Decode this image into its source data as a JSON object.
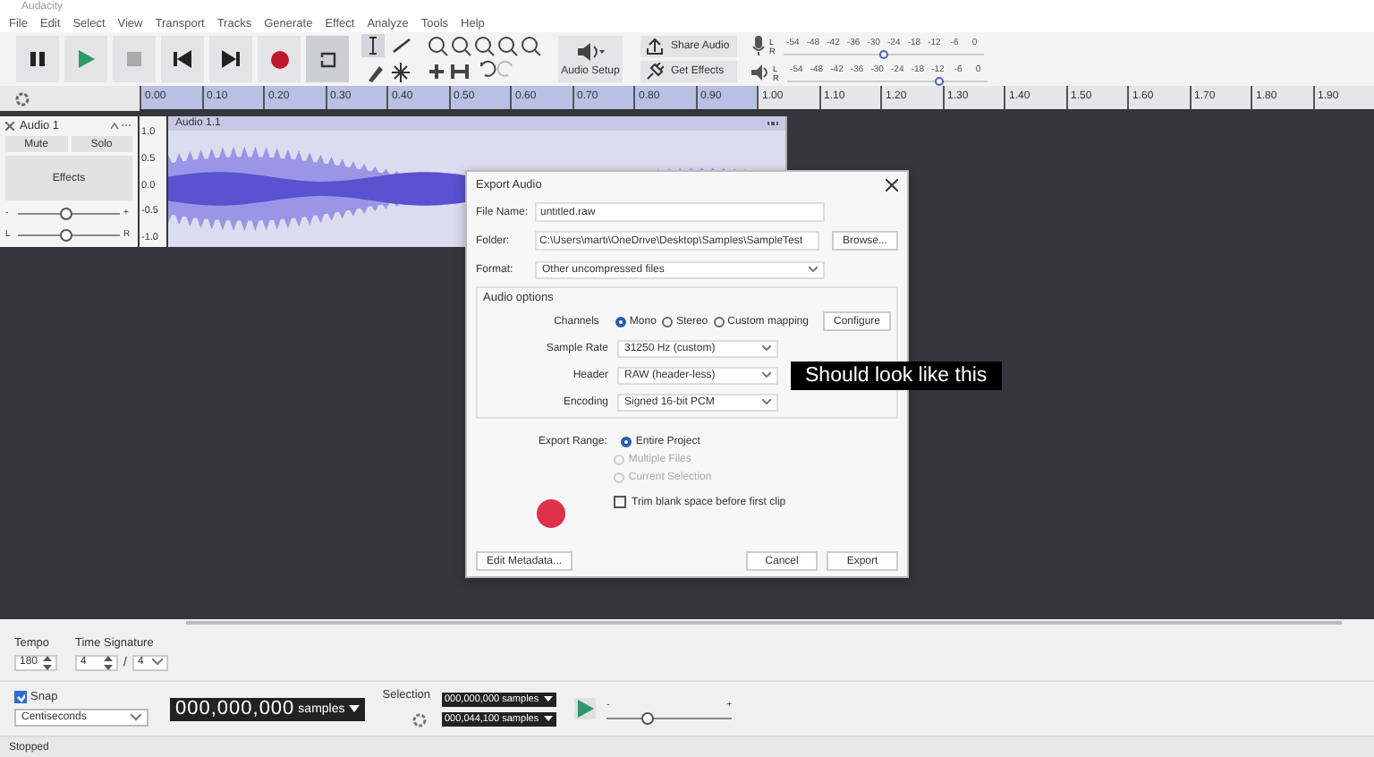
{
  "window": {
    "title": "Audacity"
  },
  "menu": [
    "File",
    "Edit",
    "Select",
    "View",
    "Transport",
    "Tracks",
    "Generate",
    "Effect",
    "Analyze",
    "Tools",
    "Help"
  ],
  "transport": [
    {
      "kind": "pause",
      "on": false
    },
    {
      "kind": "play",
      "on": false
    },
    {
      "kind": "stop",
      "on": false
    },
    {
      "kind": "skip-start",
      "on": false
    },
    {
      "kind": "skip-end",
      "on": false
    },
    {
      "kind": "record",
      "on": false
    },
    {
      "kind": "loop",
      "on": true
    }
  ],
  "audio_setup": "Audio Setup",
  "share_audio": "Share Audio",
  "get_effects": "Get Effects",
  "meters": [
    {
      "kind": "record",
      "channels": [
        "L",
        "R"
      ],
      "scale": [
        "-54",
        "-48",
        "-42",
        "-36",
        "-30",
        "-24",
        "-18",
        "-12",
        "-6",
        "0"
      ],
      "level": 0.5
    },
    {
      "kind": "playback",
      "channels": [
        "L",
        "R"
      ],
      "scale": [
        "-54",
        "-48",
        "-42",
        "-36",
        "-30",
        "-24",
        "-18",
        "-12",
        "-6",
        "0"
      ],
      "level": 0.76
    }
  ],
  "ruler": {
    "ticks": [
      "0.00",
      "0.10",
      "0.20",
      "0.30",
      "0.40",
      "0.50",
      "0.60",
      "0.70",
      "0.80",
      "0.90",
      "1.00",
      "1.10",
      "1.20",
      "1.30",
      "1.40",
      "1.50",
      "1.60",
      "1.70",
      "1.80",
      "1.90"
    ]
  },
  "track": {
    "name": "Audio 1",
    "mute": "Mute",
    "solo": "Solo",
    "effects": "Effects",
    "gain_labels": [
      "-",
      "+"
    ],
    "gain": {
      "level": 0.48
    },
    "pan_labels": [
      "L",
      "R"
    ],
    "pan": {
      "level": 0.48
    },
    "scale": [
      "1.0",
      "0.5",
      "0.0",
      "-0.5",
      "-1.0"
    ],
    "clip_title": "Audio 1.1"
  },
  "export_dialog": {
    "title": "Export Audio",
    "file_name": {
      "label": "File Name:",
      "value": "untitled.raw"
    },
    "folder": {
      "label": "Folder:",
      "value": "C:\\Users\\marti\\OneDrive\\Desktop\\Samples\\SampleTest",
      "button": "Browse..."
    },
    "format": {
      "label": "Format:",
      "value": "Other uncompressed files"
    },
    "audio_options": {
      "title": "Audio options",
      "channels_label": "Channels",
      "channels": [
        {
          "label": "Mono",
          "selected": true
        },
        {
          "label": "Stereo",
          "selected": false
        },
        {
          "label": "Custom mapping",
          "selected": false
        }
      ],
      "configure": "Configure",
      "dropdowns": [
        {
          "label": "Sample Rate",
          "value": "31250 Hz (custom)"
        },
        {
          "label": "Header",
          "value": "RAW (header-less)"
        },
        {
          "label": "Encoding",
          "value": "Signed 16-bit PCM"
        }
      ]
    },
    "export_range_label": "Export Range:",
    "export_range": [
      {
        "label": "Entire Project",
        "selected": true,
        "disabled": false
      },
      {
        "label": "Multiple Files",
        "selected": false,
        "disabled": true
      },
      {
        "label": "Current Selection",
        "selected": false,
        "disabled": true
      }
    ],
    "trim": {
      "label": "Trim blank space before first clip",
      "checked": false
    },
    "edit_metadata": "Edit Metadata...",
    "cancel": "Cancel",
    "export": "Export"
  },
  "caption": "Should look like this",
  "tempo": {
    "label": "Tempo",
    "value": "180"
  },
  "time_signature": {
    "label": "Time Signature",
    "upper": "4",
    "separator": "/",
    "lower": "4"
  },
  "snap": {
    "label": "Snap",
    "checked": true,
    "unit": "Centiseconds"
  },
  "time": {
    "value": "000,000,000",
    "unit": "samples"
  },
  "selection": {
    "label": "Selection",
    "start": "000,000,000 samples",
    "end": "000,044,100 samples"
  },
  "play_speed": {
    "min": "-",
    "max": "+",
    "level": 0.33
  },
  "status_bar": "Stopped"
}
